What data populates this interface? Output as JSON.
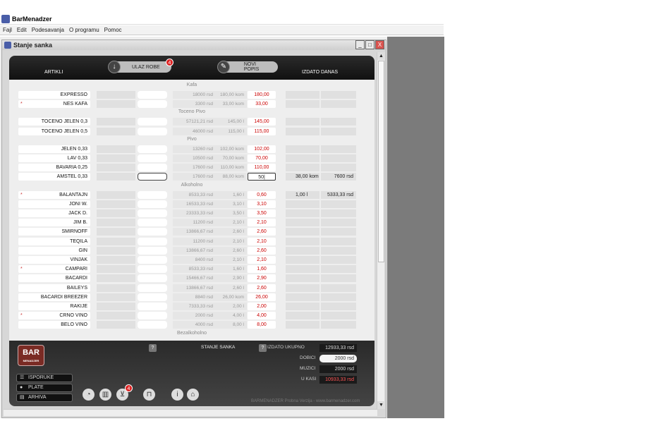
{
  "app_title": "BarMenadzer",
  "menu": [
    "Fajl",
    "Edit",
    "Podesavanja",
    "O programu",
    "Pomoc"
  ],
  "child_title": "Stanje sanka",
  "window_buttons": [
    "_",
    "□",
    "X"
  ],
  "header": {
    "artikli": "ARTIKLI",
    "ulaz_robe": "ULAZ ROBE",
    "ulaz_badge": "4",
    "novi_popis": "NOVI POPIS",
    "izdato_danas": "IZDATO DANAS"
  },
  "sections": [
    {
      "label": "Kafa",
      "items": [
        {
          "name": "EXPRESSO",
          "star": false,
          "rsd": "18000 rsd",
          "qty": "180,00 kom",
          "red": "180,00",
          "iz1": "",
          "iz2": ""
        },
        {
          "name": "NES KAFA",
          "star": true,
          "rsd": "3300 rsd",
          "qty": "33,00 kom",
          "red": "33,00",
          "iz1": "",
          "iz2": ""
        }
      ]
    },
    {
      "label": "Toceno Pivo",
      "items": [
        {
          "name": "TOCENO JELEN 0,3",
          "star": false,
          "rsd": "57121,21 rsd",
          "qty": "145,00  l",
          "red": "145,00",
          "iz1": "",
          "iz2": ""
        },
        {
          "name": "TOCENO JELEN 0,5",
          "star": false,
          "rsd": "46000 rsd",
          "qty": "115,00  l",
          "red": "115,00",
          "iz1": "",
          "iz2": ""
        }
      ]
    },
    {
      "label": "Pivo",
      "items": [
        {
          "name": "JELEN 0,33",
          "star": false,
          "rsd": "13260 rsd",
          "qty": "102,00 kom",
          "red": "102,00",
          "iz1": "",
          "iz2": ""
        },
        {
          "name": "LAV 0,33",
          "star": false,
          "rsd": "10500 rsd",
          "qty": "70,00 kom",
          "red": "70,00",
          "iz1": "",
          "iz2": ""
        },
        {
          "name": "BAVARIA 0,25",
          "star": false,
          "rsd": "17600 rsd",
          "qty": "110,00 kom",
          "red": "110,00",
          "iz1": "",
          "iz2": ""
        },
        {
          "name": "AMSTEL 0,33",
          "star": false,
          "rsd": "17600 rsd",
          "qty": "88,00 kom",
          "red": "50|",
          "iz1": "38,00 kom",
          "iz2": "7600 rsd",
          "active": true
        }
      ]
    },
    {
      "label": "Alkoholno",
      "items": [
        {
          "name": "BALANTAJN",
          "star": true,
          "rsd": "8533,33 rsd",
          "qty": "1,60  l",
          "red": "0,60",
          "iz1": "1,00  l",
          "iz2": "5333,33 rsd"
        },
        {
          "name": "JONI W.",
          "star": false,
          "rsd": "16533,33 rsd",
          "qty": "3,10  l",
          "red": "3,10",
          "iz1": "",
          "iz2": ""
        },
        {
          "name": "JACK D.",
          "star": false,
          "rsd": "23333,33 rsd",
          "qty": "3,50  l",
          "red": "3,50",
          "iz1": "",
          "iz2": ""
        },
        {
          "name": "JIM B.",
          "star": false,
          "rsd": "11200 rsd",
          "qty": "2,10  l",
          "red": "2,10",
          "iz1": "",
          "iz2": ""
        },
        {
          "name": "SMIRNOFF",
          "star": false,
          "rsd": "13866,67 rsd",
          "qty": "2,60  l",
          "red": "2,60",
          "iz1": "",
          "iz2": ""
        },
        {
          "name": "TEQILA",
          "star": false,
          "rsd": "11200 rsd",
          "qty": "2,10  l",
          "red": "2,10",
          "iz1": "",
          "iz2": ""
        },
        {
          "name": "GIN",
          "star": false,
          "rsd": "13866,67 rsd",
          "qty": "2,60  l",
          "red": "2,60",
          "iz1": "",
          "iz2": ""
        },
        {
          "name": "VINJAK",
          "star": false,
          "rsd": "8400 rsd",
          "qty": "2,10  l",
          "red": "2,10",
          "iz1": "",
          "iz2": ""
        },
        {
          "name": "CAMPARI",
          "star": true,
          "rsd": "8533,33 rsd",
          "qty": "1,60  l",
          "red": "1,60",
          "iz1": "",
          "iz2": ""
        },
        {
          "name": "BACARDI",
          "star": false,
          "rsd": "15466,67 rsd",
          "qty": "2,90  l",
          "red": "2,90",
          "iz1": "",
          "iz2": ""
        },
        {
          "name": "BAILEYS",
          "star": false,
          "rsd": "13866,67 rsd",
          "qty": "2,60  l",
          "red": "2,60",
          "iz1": "",
          "iz2": ""
        },
        {
          "name": "BACARDI BREEZER",
          "star": false,
          "rsd": "8840 rsd",
          "qty": "26,00 kom",
          "red": "26,00",
          "iz1": "",
          "iz2": ""
        },
        {
          "name": "RAKIJE",
          "star": false,
          "rsd": "7333,33 rsd",
          "qty": "2,00  l",
          "red": "2,00",
          "iz1": "",
          "iz2": ""
        },
        {
          "name": "CRNO VINO",
          "star": true,
          "rsd": "2000 rsd",
          "qty": "4,00  l",
          "red": "4,00",
          "iz1": "",
          "iz2": ""
        },
        {
          "name": "BELO VINO",
          "star": false,
          "rsd": "4000 rsd",
          "qty": "8,00  l",
          "red": "8,00",
          "iz1": "",
          "iz2": ""
        }
      ]
    },
    {
      "label": "Bezalkoholno",
      "items": []
    }
  ],
  "footer": {
    "logo_text": "BAR",
    "logo_sub": "MENADZER",
    "isporuke": "ISPORUKE",
    "plate": "PLATE",
    "arhiva": "ARHIVA",
    "stanje_sanka": "STANJE SANKA",
    "q1": "?",
    "q2": "?",
    "izdato_ukupno_label": "IZDATO UKUPNO",
    "izdato_ukupno": "12933,33 rsd",
    "dobici_label": "DOBICI",
    "dobici": "2000 rsd",
    "muzici_label": "MUZICI",
    "muzici": "2000 rsd",
    "u_kasi_label": "U KASI",
    "u_kasi": "10933,33 rsd",
    "cart_badge": "4",
    "url": "BARMENADZER Probna Verzija - www.barmenadzer.com"
  }
}
